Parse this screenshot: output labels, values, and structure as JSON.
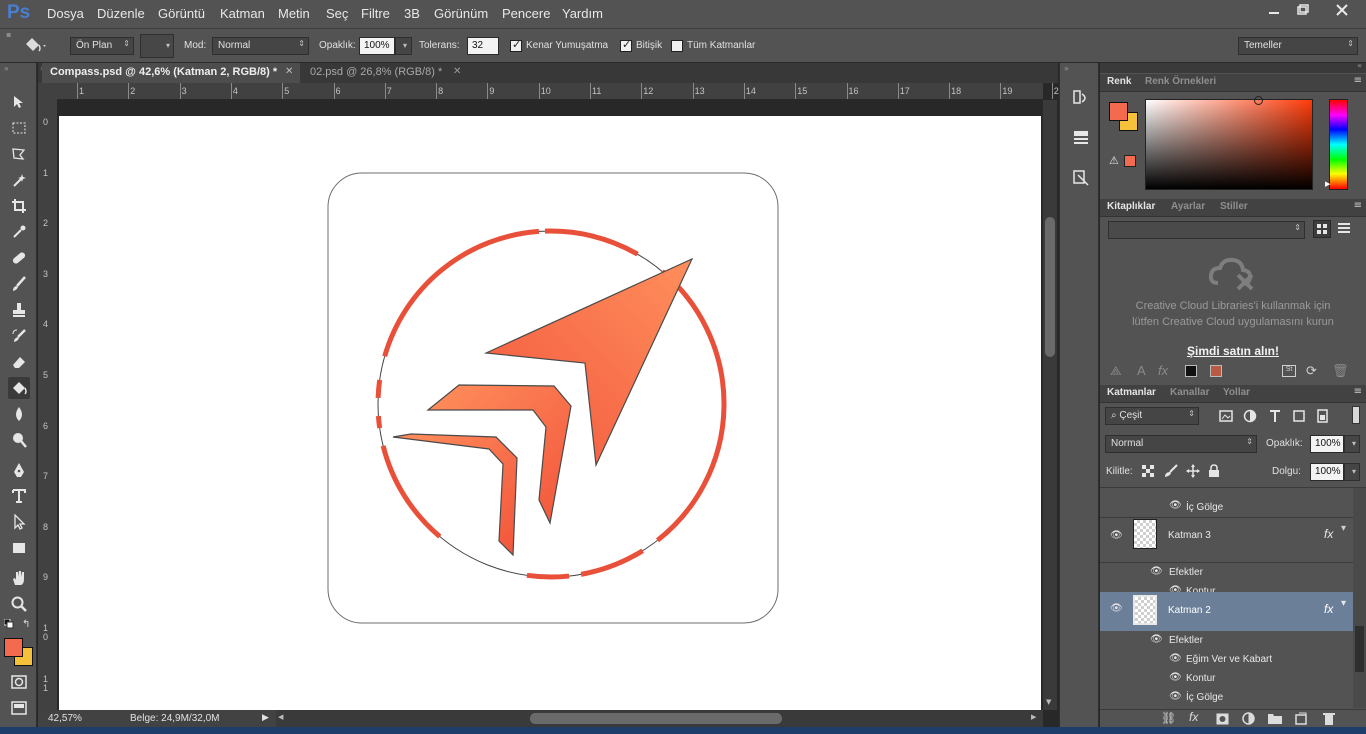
{
  "app": {
    "logo": "Ps",
    "menu": [
      "Dosya",
      "Düzenle",
      "Görüntü",
      "Katman",
      "Metin",
      "Seç",
      "Filtre",
      "3B",
      "Görünüm",
      "Pencere",
      "Yardım"
    ],
    "window_controls": [
      "minimize",
      "restore",
      "close"
    ]
  },
  "options": {
    "fill_source": "Ön Plan",
    "mode_label": "Mod:",
    "mode_value": "Normal",
    "opacity_label": "Opaklık:",
    "opacity_value": "100%",
    "tolerance_label": "Tolerans:",
    "tolerance_value": "32",
    "anti_alias": {
      "label": "Kenar Yumuşatma",
      "checked": true
    },
    "contiguous": {
      "label": "Bitişik",
      "checked": true
    },
    "all_layers": {
      "label": "Tüm Katmanlar",
      "checked": false
    },
    "workspace": "Temeller"
  },
  "documents": [
    {
      "title": "Compass.psd @ 42,6% (Katman 2, RGB/8) *",
      "active": true
    },
    {
      "title": "02.psd @ 26,8% (RGB/8) *",
      "active": false
    }
  ],
  "ruler_top": [
    "1",
    "2",
    "3",
    "4",
    "5",
    "6",
    "7",
    "8",
    "9",
    "10",
    "11",
    "12",
    "13",
    "14",
    "15",
    "16",
    "17",
    "18",
    "19",
    "2"
  ],
  "ruler_left": [
    "0",
    "1",
    "2",
    "3",
    "4",
    "5",
    "6",
    "7",
    "8",
    "9",
    "1 0",
    "1 1"
  ],
  "status": {
    "zoom": "42,57%",
    "doc": "Belge: 24,9M/32,0M"
  },
  "colors": {
    "foreground": "#f46a4e",
    "background": "#f5c13b",
    "artwork_red": "#e8503a",
    "arrow_light": "#ff8f5c",
    "arrow_dark": "#f2553c",
    "layer_selected": "#6c7f99",
    "picker_hue": "#ff3b0a"
  },
  "color_panel": {
    "tabs": [
      "Renk",
      "Renk Örnekleri"
    ]
  },
  "libraries_panel": {
    "tabs": [
      "Kitaplıklar",
      "Ayarlar",
      "Stiller"
    ],
    "message_line1": "Creative Cloud Libraries'i kullanmak için",
    "message_line2": "lütfen Creative Cloud uygulamasını kurun",
    "cta": "Şimdi satın alın!"
  },
  "layers_panel": {
    "tabs": [
      "Katmanlar",
      "Kanallar",
      "Yollar"
    ],
    "filter": "Çeşit",
    "blend_mode": "Normal",
    "opacity_label": "Opaklık:",
    "opacity_value": "100%",
    "lock_label": "Kilitle:",
    "fill_label": "Dolgu:",
    "fill_value": "100%",
    "rows": [
      {
        "kind": "effect",
        "name": "İç Gölge"
      },
      {
        "kind": "layer",
        "name": "Katman 3",
        "fx": "fx"
      },
      {
        "kind": "group",
        "name": "Efektler"
      },
      {
        "kind": "effect",
        "name": "Kontur"
      },
      {
        "kind": "layer",
        "name": "Katman 2",
        "fx": "fx",
        "selected": true
      },
      {
        "kind": "group",
        "name": "Efektler"
      },
      {
        "kind": "effect",
        "name": "Eğim Ver ve Kabart"
      },
      {
        "kind": "effect",
        "name": "Kontur"
      },
      {
        "kind": "effect",
        "name": "İç Gölge"
      }
    ]
  }
}
